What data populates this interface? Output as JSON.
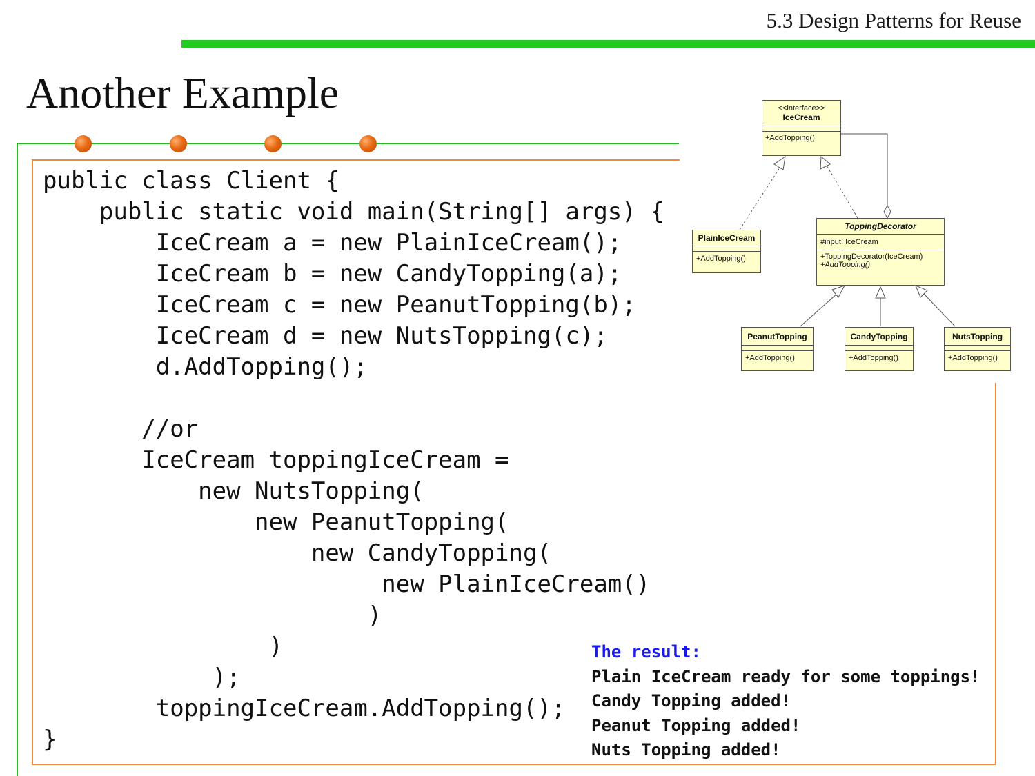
{
  "header": {
    "section_title": "5.3 Design Patterns for Reuse"
  },
  "slide": {
    "title": "Another Example"
  },
  "code": [
    "public class Client {",
    "    public static void main(String[] args) {",
    "        IceCream a = new PlainIceCream();",
    "        IceCream b = new CandyTopping(a);",
    "        IceCream c = new PeanutTopping(b);",
    "        IceCream d = new NutsTopping(c);",
    "        d.AddTopping();",
    "",
    "       //or",
    "       IceCream toppingIceCream =",
    "           new NutsTopping(",
    "               new PeanutTopping(",
    "                   new CandyTopping(",
    "                        new PlainIceCream()",
    "                       )",
    "                )",
    "            );",
    "        toppingIceCream.AddTopping();",
    "}"
  ],
  "result": {
    "header": "The result:",
    "lines": [
      "Plain IceCream ready for some toppings!",
      "Candy Topping added!",
      "Peanut Topping added!",
      "Nuts Topping added!"
    ]
  },
  "uml": {
    "icecream": {
      "stereotype": "<<interface>>",
      "name": "IceCream",
      "method": "+AddTopping()"
    },
    "plain": {
      "name": "PlainIceCream",
      "method": "+AddTopping()"
    },
    "decorator": {
      "name": "ToppingDecorator",
      "attribute": "#input: IceCream",
      "method1": "+ToppingDecorator(IceCream)",
      "method2": "+AddTopping()"
    },
    "peanut": {
      "name": "PeanutTopping",
      "method": "+AddTopping()"
    },
    "candy": {
      "name": "CandyTopping",
      "method": "+AddTopping()"
    },
    "nuts": {
      "name": "NutsTopping",
      "method": "+AddTopping()"
    }
  }
}
